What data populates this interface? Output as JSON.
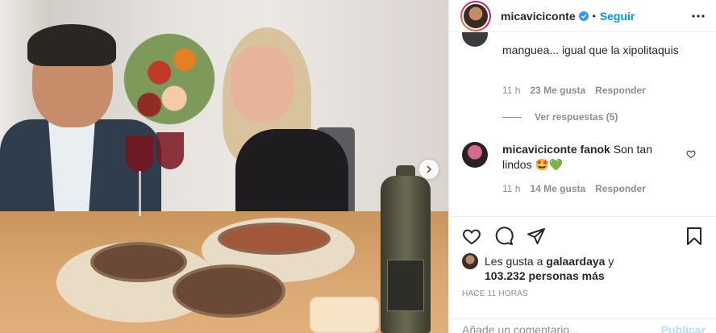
{
  "post": {
    "username": "micaviciconte",
    "verified": true,
    "separator": "•",
    "follow_label": "Seguir",
    "more_icon": "more-horizontal-icon"
  },
  "comments": [
    {
      "text": "manguea... igual que la xipolitaquis",
      "time": "11 h",
      "likes": "23 Me gusta",
      "reply_label": "Responder",
      "view_replies": "Ver respuestas (5)"
    },
    {
      "username": "micaviciconte fanok",
      "username_display": "micaviciconte fanok",
      "text": "Son tan lindos 🤩💚",
      "time": "11 h",
      "likes": "14 Me gusta",
      "reply_label": "Responder"
    }
  ],
  "likes": {
    "prefix": "Les gusta a ",
    "user": "galaardaya",
    "connector": " y ",
    "others": "103.232 personas más"
  },
  "timestamp": "HACE 11 HORAS",
  "comment_box": {
    "placeholder": "Añade un comentario...",
    "publish_label": "Publicar"
  },
  "colors": {
    "accent": "#0095f6",
    "muted": "#8e8e8e",
    "border": "#efefef",
    "publish_disabled": "#b2dffc"
  }
}
